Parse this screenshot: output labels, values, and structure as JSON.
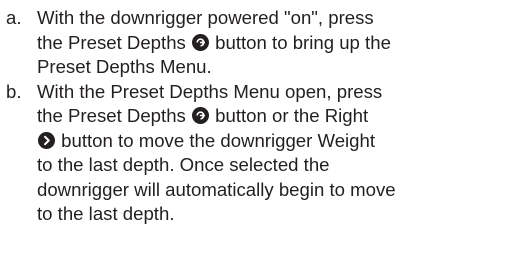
{
  "steps": [
    {
      "marker": "a.",
      "lines": [
        {
          "before": "With the downrigger powered \"on\", press",
          "icon": null,
          "after": ""
        },
        {
          "before": "the Preset Depths ",
          "icon": "preset-depths-icon",
          "after": " button to bring up the"
        },
        {
          "before": "Preset Depths Menu.",
          "icon": null,
          "after": ""
        }
      ]
    },
    {
      "marker": "b.",
      "lines": [
        {
          "before": "With the Preset Depths Menu open, press",
          "icon": null,
          "after": ""
        },
        {
          "before": "the Preset Depths ",
          "icon": "preset-depths-icon",
          "after": " button or the Right"
        },
        {
          "before": "",
          "icon": "right-arrow-icon",
          "after": " button to move the downrigger Weight"
        },
        {
          "before": "to the last depth. Once selected the",
          "icon": null,
          "after": ""
        },
        {
          "before": "downrigger will automatically begin to move",
          "icon": null,
          "after": ""
        },
        {
          "before": "to the last depth.",
          "icon": null,
          "after": ""
        }
      ]
    }
  ]
}
